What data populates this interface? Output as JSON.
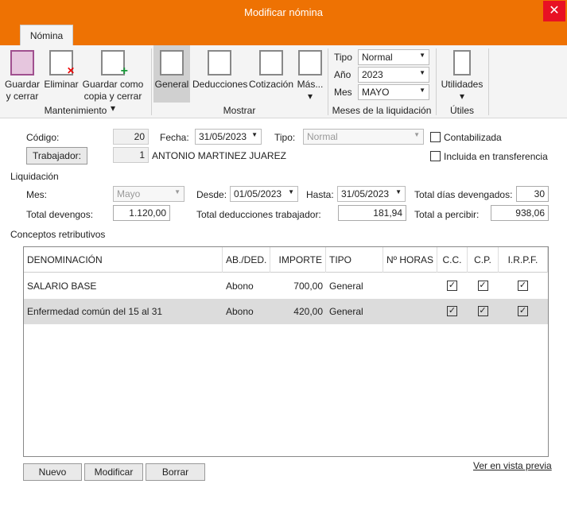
{
  "window": {
    "title": "Modificar nómina",
    "close": "✕"
  },
  "ribbon": {
    "tab": "Nómina",
    "buttons": [
      {
        "l1": "Guardar",
        "l2": "y cerrar"
      },
      {
        "l1": "Eliminar",
        "l2": ""
      },
      {
        "l1": "Guardar como",
        "l2": "copia y cerrar ▾"
      },
      {
        "l1": "General"
      },
      {
        "l1": "Deducciones"
      },
      {
        "l1": "Cotización"
      },
      {
        "l1": "Más...",
        "l2": "▾"
      },
      {
        "l1": "Utilidades",
        "l2": "▾"
      }
    ],
    "groups": [
      "Mantenimiento",
      "Mostrar",
      "Meses de la liquidación",
      "Útiles"
    ],
    "tipo_label": "Tipo",
    "tipo": "Normal",
    "anio_label": "Año",
    "anio": "2023",
    "mes_label": "Mes",
    "mes": "MAYO"
  },
  "form": {
    "codigo_label": "Código:",
    "codigo": "20",
    "fecha_label": "Fecha:",
    "fecha": "31/05/2023",
    "tipo_label": "Tipo:",
    "tipo": "Normal",
    "contabilizada": "Contabilizada",
    "transferencia": "Incluida en transferencia",
    "trabajador_btn": "Trabajador:",
    "trabajador_id": "1",
    "trabajador_nombre": "ANTONIO MARTINEZ JUAREZ",
    "liquidacion": "Liquidación",
    "mes_label": "Mes:",
    "mes": "Mayo",
    "desde_label": "Desde:",
    "desde": "01/05/2023",
    "hasta_label": "Hasta:",
    "hasta": "31/05/2023",
    "dias_label": "Total días devengados:",
    "dias": "30",
    "devengos_label": "Total devengos:",
    "devengos": "1.120,00",
    "deducciones_label": "Total deducciones trabajador:",
    "deducciones": "181,94",
    "percibir_label": "Total a percibir:",
    "percibir": "938,06"
  },
  "conceptos": {
    "title": "Conceptos retributivos",
    "headers": [
      "DENOMINACIÓN",
      "AB./DED.",
      "IMPORTE",
      "TIPO",
      "Nº HORAS",
      "C.C.",
      "C.P.",
      "I.R.P.F."
    ],
    "rows": [
      {
        "den": "SALARIO BASE",
        "ab": "Abono",
        "imp": "700,00",
        "tipo": "General",
        "horas": "",
        "cc": true,
        "cp": true,
        "irpf": true
      },
      {
        "den": "Enfermedad común del 15 al 31",
        "ab": "Abono",
        "imp": "420,00",
        "tipo": "General",
        "horas": "",
        "cc": true,
        "cp": true,
        "irpf": true
      }
    ]
  },
  "footer": {
    "nuevo": "Nuevo",
    "modificar": "Modificar",
    "borrar": "Borrar",
    "preview": "Ver en vista previa"
  }
}
